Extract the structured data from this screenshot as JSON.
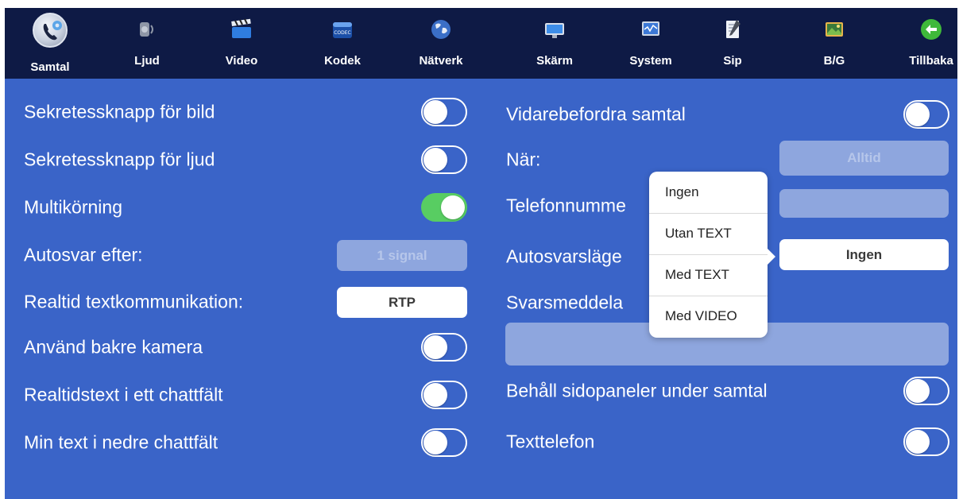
{
  "toolbar": {
    "items": [
      {
        "label": "Samtal",
        "icon": "phone-gear-icon"
      },
      {
        "label": "Ljud",
        "icon": "speaker-icon"
      },
      {
        "label": "Video",
        "icon": "clapperboard-icon"
      },
      {
        "label": "Kodek",
        "icon": "codec-icon",
        "icon_text": "CODEC"
      },
      {
        "label": "Nätverk",
        "icon": "globe-icon"
      },
      {
        "label": "Skärm",
        "icon": "monitor-icon"
      },
      {
        "label": "System",
        "icon": "system-monitor-icon"
      },
      {
        "label": "Sip",
        "icon": "sip-notepad-icon"
      },
      {
        "label": "B/G",
        "icon": "image-icon"
      },
      {
        "label": "Tillbaka",
        "icon": "back-arrow-icon"
      }
    ],
    "active": "Samtal"
  },
  "left": {
    "video_privacy": {
      "label": "Sekretessknapp för bild",
      "on": false
    },
    "audio_privacy": {
      "label": "Sekretessknapp för ljud",
      "on": false
    },
    "multitasking": {
      "label": "Multikörning",
      "on": true
    },
    "autoanswer_after": {
      "label": "Autosvar efter:",
      "value": "1 signal"
    },
    "realtime_text": {
      "label": "Realtid textkommunikation:",
      "value": "RTP"
    },
    "rear_camera": {
      "label": "Använd bakre kamera",
      "on": false
    },
    "rtt_one_chat": {
      "label": "Realtidstext i ett chattfält",
      "on": false
    },
    "my_text_lower": {
      "label": "Min text i nedre chattfält",
      "on": false
    }
  },
  "right": {
    "call_forward": {
      "label": "Vidarebefordra samtal",
      "on": false
    },
    "when": {
      "label": "När:",
      "value": "Alltid"
    },
    "phone_number": {
      "label": "Telefonnumme",
      "value": ""
    },
    "autoanswer_mode": {
      "label": "Autosvarsläge",
      "value": "Ingen"
    },
    "answer_message": {
      "label": "Svarsmeddela",
      "value": ""
    },
    "keep_side_panels": {
      "label": "Behåll sidopaneler under samtal",
      "on": false
    },
    "text_phone": {
      "label": "Texttelefon",
      "on": false
    }
  },
  "popover": {
    "options": [
      "Ingen",
      "Utan TEXT",
      "Med TEXT",
      "Med VIDEO"
    ]
  },
  "colors": {
    "background": "#3a64c8",
    "toolbar": "#0e1a45",
    "toggle_on": "#58cd62",
    "disabled_field": "#8ea6de"
  }
}
